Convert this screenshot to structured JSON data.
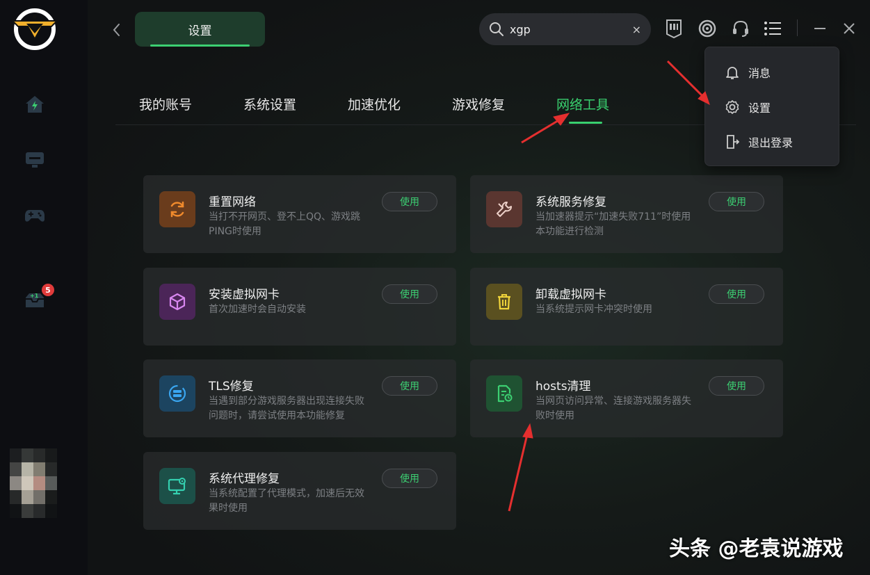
{
  "header": {
    "title": "设置",
    "search_value": "xgp",
    "clear_label": "×"
  },
  "sidebar": {
    "badge_count": "5",
    "items": [
      "home-icon",
      "monitor-icon",
      "gamepad-icon",
      "inbox-icon"
    ]
  },
  "tabs": [
    {
      "label": "我的账号"
    },
    {
      "label": "系统设置"
    },
    {
      "label": "加速优化"
    },
    {
      "label": "游戏修复"
    },
    {
      "label": "网络工具",
      "active": true
    }
  ],
  "menu": {
    "items": [
      {
        "label": "消息",
        "icon": "bell-icon"
      },
      {
        "label": "设置",
        "icon": "gear-icon"
      },
      {
        "label": "退出登录",
        "icon": "logout-icon"
      }
    ]
  },
  "tools": [
    {
      "title": "重置网络",
      "desc": "当打不开网页、登不上QQ、游戏跳PING时使用",
      "button": "使用",
      "icon": "refresh-icon",
      "color": "#f08a2c"
    },
    {
      "title": "系统服务修复",
      "desc": "当加速器提示“加速失败711”时使用本功能进行检测",
      "button": "使用",
      "icon": "wrench-icon",
      "color": "#e8856c"
    },
    {
      "title": "安装虚拟网卡",
      "desc": "首次加速时会自动安装",
      "button": "使用",
      "icon": "cube-icon",
      "color": "#c45ae0"
    },
    {
      "title": "卸载虚拟网卡",
      "desc": "当系统提示网卡冲突时使用",
      "button": "使用",
      "icon": "trash-icon",
      "color": "#e6c72b"
    },
    {
      "title": "TLS修复",
      "desc": "当遇到部分游戏服务器出现连接失败问题时，请尝试使用本功能修复",
      "button": "使用",
      "icon": "server-refresh-icon",
      "color": "#3aa6f0"
    },
    {
      "title": "hosts清理",
      "desc": "当网页访问异常、连接游戏服务器失败时使用",
      "button": "使用",
      "icon": "file-clean-icon",
      "color": "#3ccf72"
    },
    {
      "title": "系统代理修复",
      "desc": "当系统配置了代理模式，加速后无效果时使用",
      "button": "使用",
      "icon": "monitor-gear-icon",
      "color": "#34d0b0"
    }
  ],
  "watermark": "头条 @老袁说游戏",
  "colors": {
    "accent": "#39d06f",
    "sidebar_bg": "#0d0e12",
    "card_bg": "#2a2c2e",
    "arrow": "#e52f2f"
  }
}
